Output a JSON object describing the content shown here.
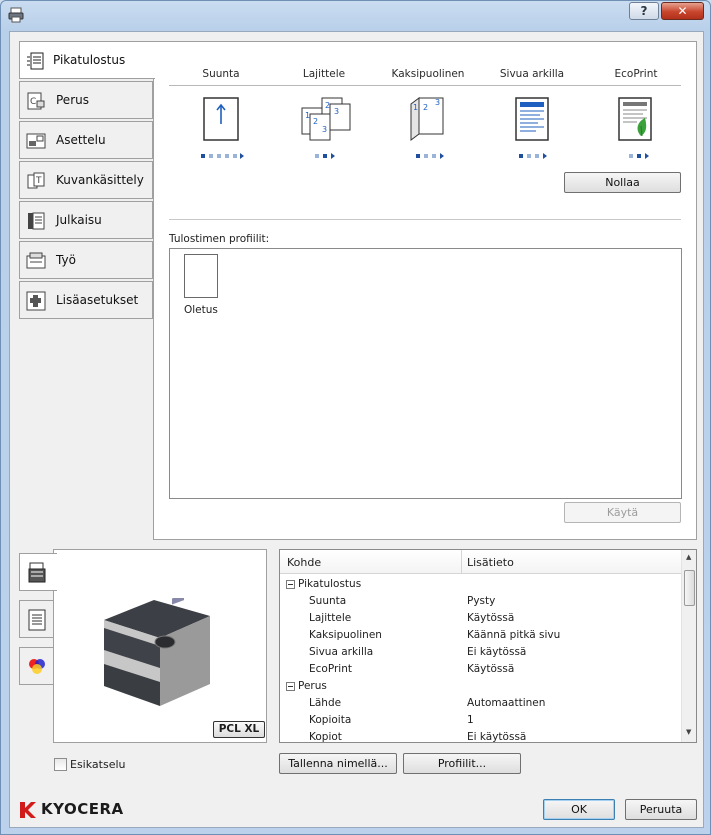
{
  "window": {
    "title": "",
    "help_label": "?",
    "close_label": "✕"
  },
  "sidebar": {
    "tabs": [
      {
        "label": "Pikatulostus",
        "icon": "quick-print-icon",
        "active": true
      },
      {
        "label": "Perus",
        "icon": "basic-icon"
      },
      {
        "label": "Asettelu",
        "icon": "layout-icon"
      },
      {
        "label": "Kuvankäsittely",
        "icon": "imaging-icon"
      },
      {
        "label": "Julkaisu",
        "icon": "publishing-icon"
      },
      {
        "label": "Työ",
        "icon": "job-icon"
      },
      {
        "label": "Lisäasetukset",
        "icon": "advanced-icon"
      }
    ]
  },
  "quick_print": {
    "columns": [
      {
        "label": "Suunta",
        "icon": "orientation-icon",
        "dots": 5,
        "selected_dot": 0
      },
      {
        "label": "Lajittele",
        "icon": "collate-icon",
        "dots": 3,
        "selected_dot": 1
      },
      {
        "label": "Kaksipuolinen",
        "icon": "duplex-icon",
        "dots": 3,
        "selected_dot": 0
      },
      {
        "label": "Sivua arkilla",
        "icon": "pages-per-sheet-icon",
        "dots": 3,
        "selected_dot": 0
      },
      {
        "label": "EcoPrint",
        "icon": "ecoprint-icon",
        "dots": 2,
        "selected_dot": 1
      }
    ],
    "reset_label": "Nollaa",
    "profiles_label": "Tulostimen profiilit:",
    "profiles": [
      {
        "name": "Oletus"
      }
    ],
    "apply_label": "Käytä"
  },
  "preview": {
    "tabs": [
      "printer-preview-icon",
      "page-preview-icon",
      "color-preview-icon"
    ],
    "badge": "PCL XL",
    "checkbox_label": "Esikatselu",
    "checked": false
  },
  "summary": {
    "col1": "Kohde",
    "col2": "Lisätieto",
    "rows": [
      {
        "group": true,
        "key": "Pikatulostus"
      },
      {
        "key": "Suunta",
        "value": "Pysty"
      },
      {
        "key": "Lajittele",
        "value": "Käytössä"
      },
      {
        "key": "Kaksipuolinen",
        "value": "Käännä pitkä sivu"
      },
      {
        "key": "Sivua arkilla",
        "value": "Ei käytössä"
      },
      {
        "key": "EcoPrint",
        "value": "Käytössä"
      },
      {
        "group": true,
        "key": "Perus"
      },
      {
        "key": "Lähde",
        "value": "Automaattinen"
      },
      {
        "key": "Kopioita",
        "value": "1"
      },
      {
        "key": "Kopiot",
        "value": "Ei käytössä"
      }
    ]
  },
  "footer": {
    "save_as_label": "Tallenna nimellä...",
    "profiles_label": "Profiilit...",
    "ok_label": "OK",
    "cancel_label": "Peruuta",
    "brand": "KYOCERA"
  },
  "colors": {
    "accent_blue": "#1f5fbf",
    "eco_green": "#3ba13b",
    "brand_red": "#d11a1a"
  }
}
